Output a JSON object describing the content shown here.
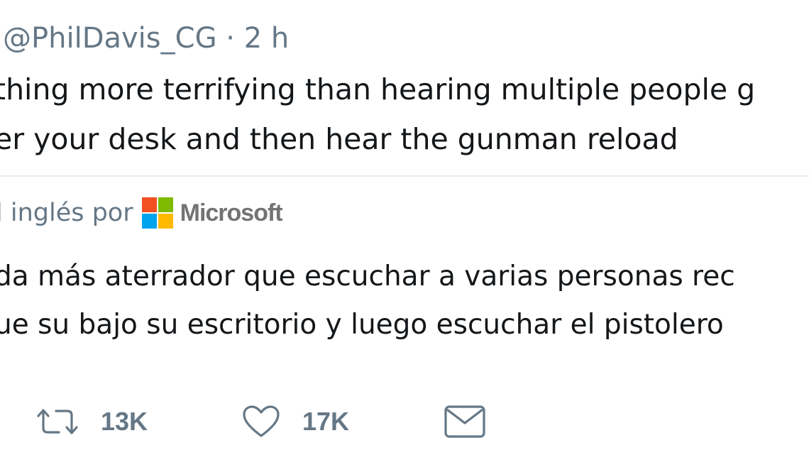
{
  "tweet": {
    "handle_line": "@PhilDavis_CG · 2 h",
    "text_lines": [
      "thing more terrifying than hearing multiple people g",
      "er your desk and then hear the gunman reload"
    ]
  },
  "translation": {
    "attribution": "l inglés por",
    "provider": "Microsoft",
    "provider_logo_colors": [
      "#f25022",
      "#7fba00",
      "#00a4ef",
      "#ffb900"
    ],
    "text_lines": [
      "da más aterrador que escuchar a varias personas rec",
      "ue su bajo su escritorio y luego escuchar el pistolero"
    ]
  },
  "actions": {
    "retweet": {
      "icon": "retweet-icon",
      "count": "13K"
    },
    "like": {
      "icon": "heart-icon",
      "count": "17K"
    },
    "message": {
      "icon": "envelope-icon"
    }
  },
  "colors": {
    "text": "#14171a",
    "secondary": "#657786",
    "divider": "#e6ecf0"
  }
}
